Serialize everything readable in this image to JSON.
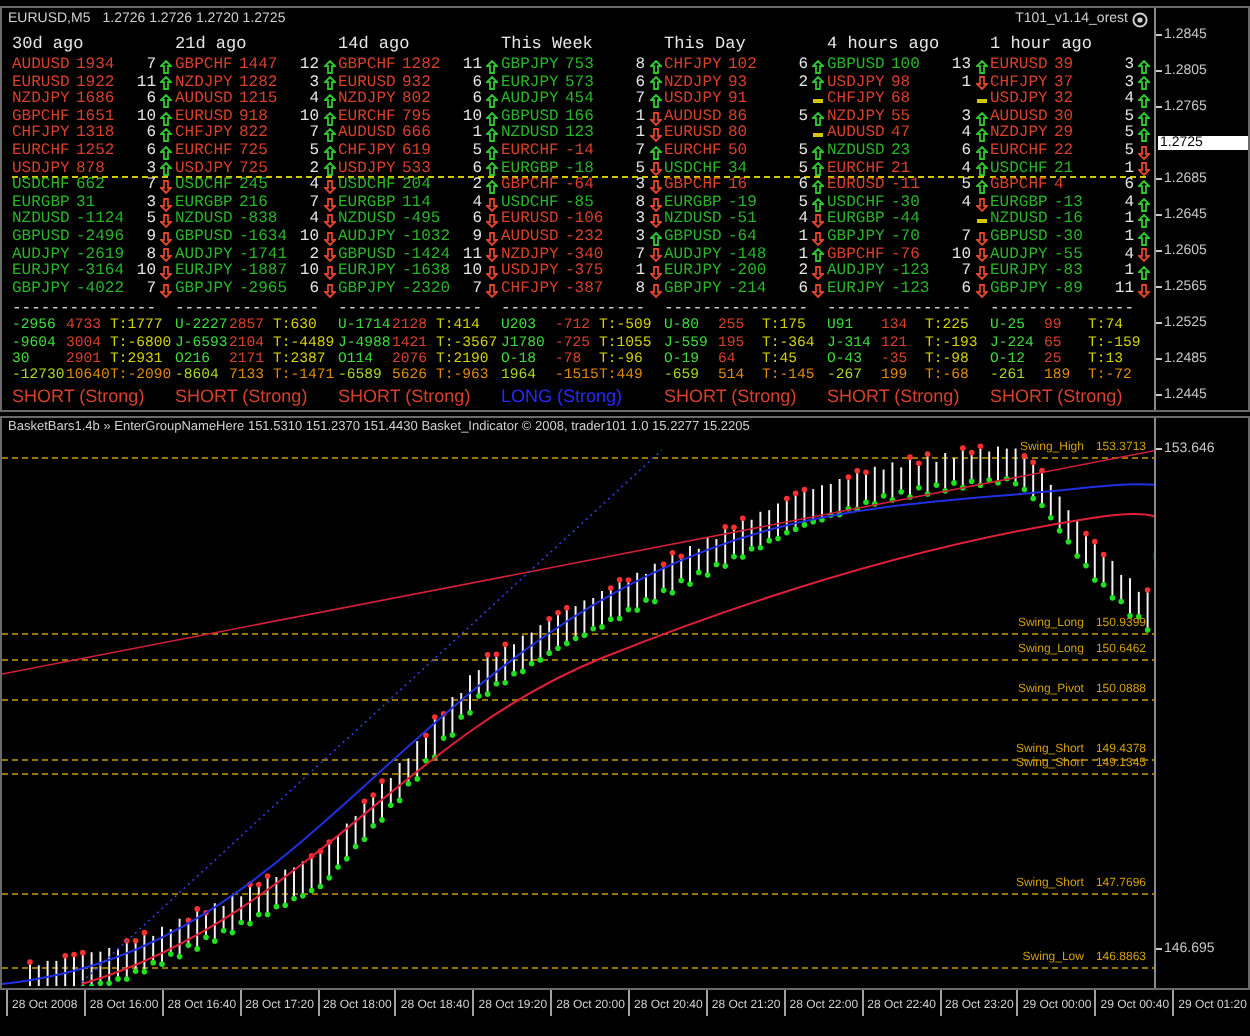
{
  "top_window": {
    "title": "EURUSD,M5",
    "quote": "1.2726 1.2726 1.2720 1.2725",
    "indicator": "T101_v1.14_orest",
    "price_axis": [
      {
        "label": "1.2845",
        "current": false
      },
      {
        "label": "1.2805",
        "current": false
      },
      {
        "label": "1.2765",
        "current": false
      },
      {
        "label": "1.2725",
        "current": true
      },
      {
        "label": "1.2685",
        "current": false
      },
      {
        "label": "1.2645",
        "current": false
      },
      {
        "label": "1.2605",
        "current": false
      },
      {
        "label": "1.2565",
        "current": false
      },
      {
        "label": "1.2525",
        "current": false
      },
      {
        "label": "1.2485",
        "current": false
      },
      {
        "label": "1.2445",
        "current": false
      }
    ],
    "columns": [
      {
        "header": "30d ago",
        "upper": [
          {
            "pair": "AUDUSD",
            "value": "1934",
            "count": "7",
            "kind": "up",
            "color": "#d8402a"
          },
          {
            "pair": "EURUSD",
            "value": "1922",
            "count": "11",
            "kind": "up",
            "color": "#d8402a"
          },
          {
            "pair": "NZDJPY",
            "value": "1686",
            "count": "6",
            "kind": "up",
            "color": "#d8402a"
          },
          {
            "pair": "GBPCHF",
            "value": "1651",
            "count": "10",
            "kind": "up",
            "color": "#d8402a"
          },
          {
            "pair": "CHFJPY",
            "value": "1318",
            "count": "6",
            "kind": "up",
            "color": "#d8402a"
          },
          {
            "pair": "EURCHF",
            "value": "1252",
            "count": "6",
            "kind": "up",
            "color": "#d8402a"
          },
          {
            "pair": "USDJPY",
            "value": "878",
            "count": "3",
            "kind": "up",
            "color": "#d8402a"
          }
        ],
        "lower": [
          {
            "pair": "USDCHF",
            "value": "662",
            "count": "7",
            "kind": "down",
            "color": "#2ab42a"
          },
          {
            "pair": "EURGBP",
            "value": "31",
            "count": "3",
            "kind": "down",
            "color": "#2ab42a"
          },
          {
            "pair": "NZDUSD",
            "value": "-1124",
            "count": "5",
            "kind": "down",
            "color": "#2ab42a"
          },
          {
            "pair": "GBPUSD",
            "value": "-2496",
            "count": "9",
            "kind": "down",
            "color": "#2ab42a"
          },
          {
            "pair": "AUDJPY",
            "value": "-2619",
            "count": "8",
            "kind": "down",
            "color": "#2ab42a"
          },
          {
            "pair": "EURJPY",
            "value": "-3164",
            "count": "10",
            "kind": "down",
            "color": "#2ab42a"
          },
          {
            "pair": "GBPJPY",
            "value": "-4022",
            "count": "7",
            "kind": "down",
            "color": "#2ab42a"
          }
        ],
        "rule": "---------------",
        "stats": [
          [
            {
              "text": "-2956",
              "color": "#3cdc3c"
            },
            {
              "text": "4733",
              "color": "#d8402a"
            },
            {
              "text": "T:1777",
              "color": "#d2d200"
            }
          ],
          [
            {
              "text": "-9604",
              "color": "#3cdc3c"
            },
            {
              "text": "3004",
              "color": "#d8402a"
            },
            {
              "text": "T:-6800",
              "color": "#d2d200"
            }
          ],
          [
            {
              "text": "30",
              "color": "#3cdc3c"
            },
            {
              "text": "2901",
              "color": "#d8402a"
            },
            {
              "text": "T:2931",
              "color": "#d2d200"
            }
          ],
          [
            {
              "text": "-12730",
              "color": "#a8d820"
            },
            {
              "text": "10640",
              "color": "#e08a00"
            },
            {
              "text": "T:-2090",
              "color": "#e08a00"
            }
          ]
        ],
        "signal": {
          "text": "SHORT (Strong)",
          "kind": "short"
        }
      },
      {
        "header": "21d ago",
        "upper": [
          {
            "pair": "GBPCHF",
            "value": "1447",
            "count": "12",
            "kind": "up",
            "color": "#d8402a"
          },
          {
            "pair": "NZDJPY",
            "value": "1282",
            "count": "3",
            "kind": "up",
            "color": "#d8402a"
          },
          {
            "pair": "AUDUSD",
            "value": "1215",
            "count": "4",
            "kind": "up",
            "color": "#d8402a"
          },
          {
            "pair": "EURUSD",
            "value": "918",
            "count": "10",
            "kind": "up",
            "color": "#d8402a"
          },
          {
            "pair": "CHFJPY",
            "value": "822",
            "count": "7",
            "kind": "up",
            "color": "#d8402a"
          },
          {
            "pair": "EURCHF",
            "value": "725",
            "count": "5",
            "kind": "up",
            "color": "#d8402a"
          },
          {
            "pair": "USDJPY",
            "value": "725",
            "count": "2",
            "kind": "up",
            "color": "#d8402a"
          }
        ],
        "lower": [
          {
            "pair": "USDCHF",
            "value": "245",
            "count": "4",
            "kind": "down",
            "color": "#2ab42a"
          },
          {
            "pair": "EURGBP",
            "value": "216",
            "count": "7",
            "kind": "down",
            "color": "#2ab42a"
          },
          {
            "pair": "NZDUSD",
            "value": "-838",
            "count": "4",
            "kind": "down",
            "color": "#2ab42a"
          },
          {
            "pair": "GBPUSD",
            "value": "-1634",
            "count": "10",
            "kind": "down",
            "color": "#2ab42a"
          },
          {
            "pair": "AUDJPY",
            "value": "-1741",
            "count": "2",
            "kind": "down",
            "color": "#2ab42a"
          },
          {
            "pair": "EURJPY",
            "value": "-1887",
            "count": "10",
            "kind": "down",
            "color": "#2ab42a"
          },
          {
            "pair": "GBPJPY",
            "value": "-2965",
            "count": "6",
            "kind": "down",
            "color": "#2ab42a"
          }
        ],
        "rule": "---------------",
        "stats": [
          [
            {
              "text": "U-2227",
              "color": "#3cdc3c"
            },
            {
              "text": "2857",
              "color": "#d8402a"
            },
            {
              "text": "T:630",
              "color": "#d2d200"
            }
          ],
          [
            {
              "text": "J-6593",
              "color": "#3cdc3c"
            },
            {
              "text": "2104",
              "color": "#d8402a"
            },
            {
              "text": "T:-4489",
              "color": "#d2d200"
            }
          ],
          [
            {
              "text": "O216",
              "color": "#3cdc3c"
            },
            {
              "text": "2171",
              "color": "#d8402a"
            },
            {
              "text": "T:2387",
              "color": "#d2d200"
            }
          ],
          [
            {
              "text": "-8604",
              "color": "#a8d820"
            },
            {
              "text": "7133",
              "color": "#e08a00"
            },
            {
              "text": "T:-1471",
              "color": "#e08a00"
            }
          ]
        ],
        "signal": {
          "text": "SHORT (Strong)",
          "kind": "short"
        }
      },
      {
        "header": "14d ago",
        "upper": [
          {
            "pair": "GBPCHF",
            "value": "1282",
            "count": "11",
            "kind": "up",
            "color": "#d8402a"
          },
          {
            "pair": "EURUSD",
            "value": "932",
            "count": "6",
            "kind": "up",
            "color": "#d8402a"
          },
          {
            "pair": "NZDJPY",
            "value": "802",
            "count": "6",
            "kind": "up",
            "color": "#d8402a"
          },
          {
            "pair": "EURCHF",
            "value": "795",
            "count": "10",
            "kind": "up",
            "color": "#d8402a"
          },
          {
            "pair": "AUDUSD",
            "value": "666",
            "count": "1",
            "kind": "up",
            "color": "#d8402a"
          },
          {
            "pair": "CHFJPY",
            "value": "619",
            "count": "5",
            "kind": "up",
            "color": "#d8402a"
          },
          {
            "pair": "USDJPY",
            "value": "533",
            "count": "6",
            "kind": "up",
            "color": "#d8402a"
          }
        ],
        "lower": [
          {
            "pair": "USDCHF",
            "value": "204",
            "count": "2",
            "kind": "up",
            "color": "#2ab42a"
          },
          {
            "pair": "EURGBP",
            "value": "114",
            "count": "4",
            "kind": "down",
            "color": "#2ab42a"
          },
          {
            "pair": "NZDUSD",
            "value": "-495",
            "count": "6",
            "kind": "down",
            "color": "#2ab42a"
          },
          {
            "pair": "AUDJPY",
            "value": "-1032",
            "count": "9",
            "kind": "down",
            "color": "#2ab42a"
          },
          {
            "pair": "GBPUSD",
            "value": "-1424",
            "count": "11",
            "kind": "down",
            "color": "#2ab42a"
          },
          {
            "pair": "EURJPY",
            "value": "-1638",
            "count": "10",
            "kind": "down",
            "color": "#2ab42a"
          },
          {
            "pair": "GBPJPY",
            "value": "-2320",
            "count": "7",
            "kind": "down",
            "color": "#2ab42a"
          }
        ],
        "rule": "---------------",
        "stats": [
          [
            {
              "text": "U-1714",
              "color": "#3cdc3c"
            },
            {
              "text": "2128",
              "color": "#d8402a"
            },
            {
              "text": "T:414",
              "color": "#d2d200"
            }
          ],
          [
            {
              "text": "J-4988",
              "color": "#3cdc3c"
            },
            {
              "text": "1421",
              "color": "#d8402a"
            },
            {
              "text": "T:-3567",
              "color": "#d2d200"
            }
          ],
          [
            {
              "text": "O114",
              "color": "#3cdc3c"
            },
            {
              "text": "2076",
              "color": "#d8402a"
            },
            {
              "text": "T:2190",
              "color": "#d2d200"
            }
          ],
          [
            {
              "text": "-6589",
              "color": "#a8d820"
            },
            {
              "text": "5626",
              "color": "#e08a00"
            },
            {
              "text": "T:-963",
              "color": "#e08a00"
            }
          ]
        ],
        "signal": {
          "text": "SHORT (Strong)",
          "kind": "short"
        }
      },
      {
        "header": "This Week",
        "upper": [
          {
            "pair": "GBPJPY",
            "value": "753",
            "count": "8",
            "kind": "up",
            "color": "#2ab42a"
          },
          {
            "pair": "EURJPY",
            "value": "573",
            "count": "6",
            "kind": "up",
            "color": "#2ab42a"
          },
          {
            "pair": "AUDJPY",
            "value": "454",
            "count": "7",
            "kind": "up",
            "color": "#2ab42a"
          },
          {
            "pair": "GBPUSD",
            "value": "166",
            "count": "1",
            "kind": "down",
            "color": "#2ab42a"
          },
          {
            "pair": "NZDUSD",
            "value": "123",
            "count": "1",
            "kind": "down",
            "color": "#2ab42a"
          },
          {
            "pair": "EURCHF",
            "value": "-14",
            "count": "7",
            "kind": "up",
            "color": "#d8402a"
          },
          {
            "pair": "EURGBP",
            "value": "-18",
            "count": "5",
            "kind": "down",
            "color": "#2ab42a"
          }
        ],
        "lower": [
          {
            "pair": "GBPCHF",
            "value": "-64",
            "count": "3",
            "kind": "down",
            "color": "#d8402a"
          },
          {
            "pair": "USDCHF",
            "value": "-85",
            "count": "8",
            "kind": "down",
            "color": "#2ab42a"
          },
          {
            "pair": "EURUSD",
            "value": "-106",
            "count": "3",
            "kind": "down",
            "color": "#d8402a"
          },
          {
            "pair": "AUDUSD",
            "value": "-232",
            "count": "3",
            "kind": "up",
            "color": "#d8402a"
          },
          {
            "pair": "NZDJPY",
            "value": "-340",
            "count": "7",
            "kind": "down",
            "color": "#d8402a"
          },
          {
            "pair": "USDJPY",
            "value": "-375",
            "count": "1",
            "kind": "down",
            "color": "#d8402a"
          },
          {
            "pair": "CHFJPY",
            "value": "-387",
            "count": "8",
            "kind": "down",
            "color": "#d8402a"
          }
        ],
        "rule": "---------------",
        "stats": [
          [
            {
              "text": "U203",
              "color": "#3cdc3c"
            },
            {
              "text": "-712",
              "color": "#d8402a"
            },
            {
              "text": "T:-509",
              "color": "#d2d200"
            }
          ],
          [
            {
              "text": "J1780",
              "color": "#3cdc3c"
            },
            {
              "text": "-725",
              "color": "#d8402a"
            },
            {
              "text": "T:1055",
              "color": "#d2d200"
            }
          ],
          [
            {
              "text": "O-18",
              "color": "#3cdc3c"
            },
            {
              "text": "-78",
              "color": "#d8402a"
            },
            {
              "text": "T:-96",
              "color": "#d2d200"
            }
          ],
          [
            {
              "text": "1964",
              "color": "#a8d820"
            },
            {
              "text": "-1515",
              "color": "#e08a00"
            },
            {
              "text": "T:449",
              "color": "#e08a00"
            }
          ]
        ],
        "signal": {
          "text": "LONG (Strong)",
          "kind": "long"
        }
      },
      {
        "header": "This Day",
        "upper": [
          {
            "pair": "CHFJPY",
            "value": "102",
            "count": "6",
            "kind": "up",
            "color": "#d8402a"
          },
          {
            "pair": "NZDJPY",
            "value": "93",
            "count": "2",
            "kind": "up",
            "color": "#d8402a"
          },
          {
            "pair": "USDJPY",
            "value": "91",
            "kind": "flat",
            "color": "#d8402a"
          },
          {
            "pair": "AUDUSD",
            "value": "86",
            "count": "5",
            "kind": "up",
            "color": "#d8402a"
          },
          {
            "pair": "EURUSD",
            "value": "80",
            "kind": "flat",
            "color": "#d8402a"
          },
          {
            "pair": "EURCHF",
            "value": "50",
            "count": "5",
            "kind": "up",
            "color": "#d8402a"
          },
          {
            "pair": "USDCHF",
            "value": "34",
            "count": "5",
            "kind": "up",
            "color": "#2ab42a"
          }
        ],
        "lower": [
          {
            "pair": "GBPCHF",
            "value": "16",
            "count": "6",
            "kind": "up",
            "color": "#d8402a"
          },
          {
            "pair": "EURGBP",
            "value": "-19",
            "count": "5",
            "kind": "up",
            "color": "#2ab42a"
          },
          {
            "pair": "NZDUSD",
            "value": "-51",
            "count": "4",
            "kind": "down",
            "color": "#2ab42a"
          },
          {
            "pair": "GBPUSD",
            "value": "-64",
            "count": "1",
            "kind": "down",
            "color": "#2ab42a"
          },
          {
            "pair": "AUDJPY",
            "value": "-148",
            "count": "1",
            "kind": "up",
            "color": "#2ab42a"
          },
          {
            "pair": "EURJPY",
            "value": "-200",
            "count": "2",
            "kind": "down",
            "color": "#2ab42a"
          },
          {
            "pair": "GBPJPY",
            "value": "-214",
            "count": "6",
            "kind": "down",
            "color": "#2ab42a"
          }
        ],
        "rule": "---------------",
        "stats": [
          [
            {
              "text": "U-80",
              "color": "#3cdc3c"
            },
            {
              "text": "255",
              "color": "#d8402a"
            },
            {
              "text": "T:175",
              "color": "#d2d200"
            }
          ],
          [
            {
              "text": "J-559",
              "color": "#3cdc3c"
            },
            {
              "text": "195",
              "color": "#d8402a"
            },
            {
              "text": "T:-364",
              "color": "#d2d200"
            }
          ],
          [
            {
              "text": "O-19",
              "color": "#3cdc3c"
            },
            {
              "text": "64",
              "color": "#d8402a"
            },
            {
              "text": "T:45",
              "color": "#d2d200"
            }
          ],
          [
            {
              "text": "-659",
              "color": "#a8d820"
            },
            {
              "text": "514",
              "color": "#e08a00"
            },
            {
              "text": "T:-145",
              "color": "#e08a00"
            }
          ]
        ],
        "signal": {
          "text": "SHORT (Strong)",
          "kind": "short"
        }
      },
      {
        "header": "4 hours ago",
        "upper": [
          {
            "pair": "GBPUSD",
            "value": "100",
            "count": "13",
            "kind": "up",
            "color": "#2ab42a"
          },
          {
            "pair": "USDJPY",
            "value": "98",
            "count": "1",
            "kind": "down",
            "color": "#d8402a"
          },
          {
            "pair": "CHFJPY",
            "value": "68",
            "kind": "flat",
            "color": "#d8402a"
          },
          {
            "pair": "NZDJPY",
            "value": "55",
            "count": "3",
            "kind": "up",
            "color": "#d8402a"
          },
          {
            "pair": "AUDUSD",
            "value": "47",
            "count": "4",
            "kind": "up",
            "color": "#d8402a"
          },
          {
            "pair": "NZDUSD",
            "value": "23",
            "count": "6",
            "kind": "up",
            "color": "#2ab42a"
          },
          {
            "pair": "EURCHF",
            "value": "21",
            "count": "4",
            "kind": "up",
            "color": "#d8402a"
          }
        ],
        "lower": [
          {
            "pair": "EURUSD",
            "value": "-11",
            "count": "5",
            "kind": "up",
            "color": "#d8402a"
          },
          {
            "pair": "USDCHF",
            "value": "-30",
            "count": "4",
            "kind": "down",
            "color": "#2ab42a"
          },
          {
            "pair": "EURGBP",
            "value": "-44",
            "kind": "flat",
            "color": "#2ab42a"
          },
          {
            "pair": "GBPJPY",
            "value": "-70",
            "count": "7",
            "kind": "down",
            "color": "#2ab42a"
          },
          {
            "pair": "GBPCHF",
            "value": "-76",
            "count": "10",
            "kind": "down",
            "color": "#d8402a"
          },
          {
            "pair": "AUDJPY",
            "value": "-123",
            "count": "7",
            "kind": "down",
            "color": "#2ab42a"
          },
          {
            "pair": "EURJPY",
            "value": "-123",
            "count": "6",
            "kind": "down",
            "color": "#2ab42a"
          }
        ],
        "rule": "---------------",
        "stats": [
          [
            {
              "text": "U91",
              "color": "#3cdc3c"
            },
            {
              "text": "134",
              "color": "#d8402a"
            },
            {
              "text": "T:225",
              "color": "#d2d200"
            }
          ],
          [
            {
              "text": "J-314",
              "color": "#3cdc3c"
            },
            {
              "text": "121",
              "color": "#d8402a"
            },
            {
              "text": "T:-193",
              "color": "#d2d200"
            }
          ],
          [
            {
              "text": "O-43",
              "color": "#3cdc3c"
            },
            {
              "text": "-35",
              "color": "#d8402a"
            },
            {
              "text": "T:-98",
              "color": "#d2d200"
            }
          ],
          [
            {
              "text": "-267",
              "color": "#a8d820"
            },
            {
              "text": "199",
              "color": "#e08a00"
            },
            {
              "text": "T:-68",
              "color": "#e08a00"
            }
          ]
        ],
        "signal": {
          "text": "SHORT (Strong)",
          "kind": "short"
        }
      },
      {
        "header": "1 hour ago",
        "upper": [
          {
            "pair": "EURUSD",
            "value": "39",
            "count": "3",
            "kind": "up",
            "color": "#d8402a"
          },
          {
            "pair": "CHFJPY",
            "value": "37",
            "count": "3",
            "kind": "up",
            "color": "#d8402a"
          },
          {
            "pair": "USDJPY",
            "value": "32",
            "count": "4",
            "kind": "up",
            "color": "#d8402a"
          },
          {
            "pair": "AUDUSD",
            "value": "30",
            "count": "5",
            "kind": "up",
            "color": "#d8402a"
          },
          {
            "pair": "NZDJPY",
            "value": "29",
            "count": "5",
            "kind": "up",
            "color": "#d8402a"
          },
          {
            "pair": "EURCHF",
            "value": "22",
            "count": "5",
            "kind": "down",
            "color": "#d8402a"
          },
          {
            "pair": "USDCHF",
            "value": "21",
            "count": "1",
            "kind": "down",
            "color": "#2ab42a"
          }
        ],
        "lower": [
          {
            "pair": "GBPCHF",
            "value": "4",
            "count": "6",
            "kind": "up",
            "color": "#d8402a"
          },
          {
            "pair": "EURGBP",
            "value": "-13",
            "count": "4",
            "kind": "up",
            "color": "#2ab42a"
          },
          {
            "pair": "NZDUSD",
            "value": "-16",
            "count": "1",
            "kind": "up",
            "color": "#2ab42a"
          },
          {
            "pair": "GBPUSD",
            "value": "-30",
            "count": "1",
            "kind": "up",
            "color": "#2ab42a"
          },
          {
            "pair": "AUDJPY",
            "value": "-55",
            "count": "4",
            "kind": "down",
            "color": "#2ab42a"
          },
          {
            "pair": "EURJPY",
            "value": "-83",
            "count": "1",
            "kind": "up",
            "color": "#2ab42a"
          },
          {
            "pair": "GBPJPY",
            "value": "-89",
            "count": "11",
            "kind": "down",
            "color": "#2ab42a"
          }
        ],
        "rule": "---------------",
        "stats": [
          [
            {
              "text": "U-25",
              "color": "#3cdc3c"
            },
            {
              "text": "99",
              "color": "#d8402a"
            },
            {
              "text": "T:74",
              "color": "#d2d200"
            }
          ],
          [
            {
              "text": "J-224",
              "color": "#3cdc3c"
            },
            {
              "text": "65",
              "color": "#d8402a"
            },
            {
              "text": "T:-159",
              "color": "#d2d200"
            }
          ],
          [
            {
              "text": "O-12",
              "color": "#3cdc3c"
            },
            {
              "text": "25",
              "color": "#d8402a"
            },
            {
              "text": "T:13",
              "color": "#d2d200"
            }
          ],
          [
            {
              "text": "-261",
              "color": "#a8d820"
            },
            {
              "text": "189",
              "color": "#e08a00"
            },
            {
              "text": "T:-72",
              "color": "#e08a00"
            }
          ]
        ],
        "signal": {
          "text": "SHORT (Strong)",
          "kind": "short"
        }
      }
    ]
  },
  "bottom_window": {
    "title": "BasketBars1.4b » EnterGroupNameHere 151.5310 151.2370 151.4430 Basket_Indicator © 2008, trader101 1.0 15.2277 15.2205",
    "swing_levels": [
      {
        "label": "Swing_High",
        "value": "153.3713"
      },
      {
        "label": "Swing_Long",
        "value": "150.9399"
      },
      {
        "label": "Swing_Long",
        "value": "150.6462"
      },
      {
        "label": "Swing_Pivot",
        "value": "150.0888"
      },
      {
        "label": "Swing_Short",
        "value": "149.4378"
      },
      {
        "label": "Swing_Short",
        "value": "149.1345"
      },
      {
        "label": "Swing_Short",
        "value": "147.7696"
      },
      {
        "label": "Swing_Low",
        "value": "146.8863"
      }
    ],
    "price_axis": [
      "153.646",
      "146.695"
    ]
  },
  "time_axis": [
    "28 Oct 2008",
    "28 Oct 16:00",
    "28 Oct 16:40",
    "28 Oct 17:20",
    "28 Oct 18:00",
    "28 Oct 18:40",
    "28 Oct 19:20",
    "28 Oct 20:00",
    "28 Oct 20:40",
    "28 Oct 21:20",
    "28 Oct 22:00",
    "28 Oct 22:40",
    "28 Oct 23:20",
    "29 Oct 00:00",
    "29 Oct 00:40",
    "29 Oct 01:20"
  ]
}
